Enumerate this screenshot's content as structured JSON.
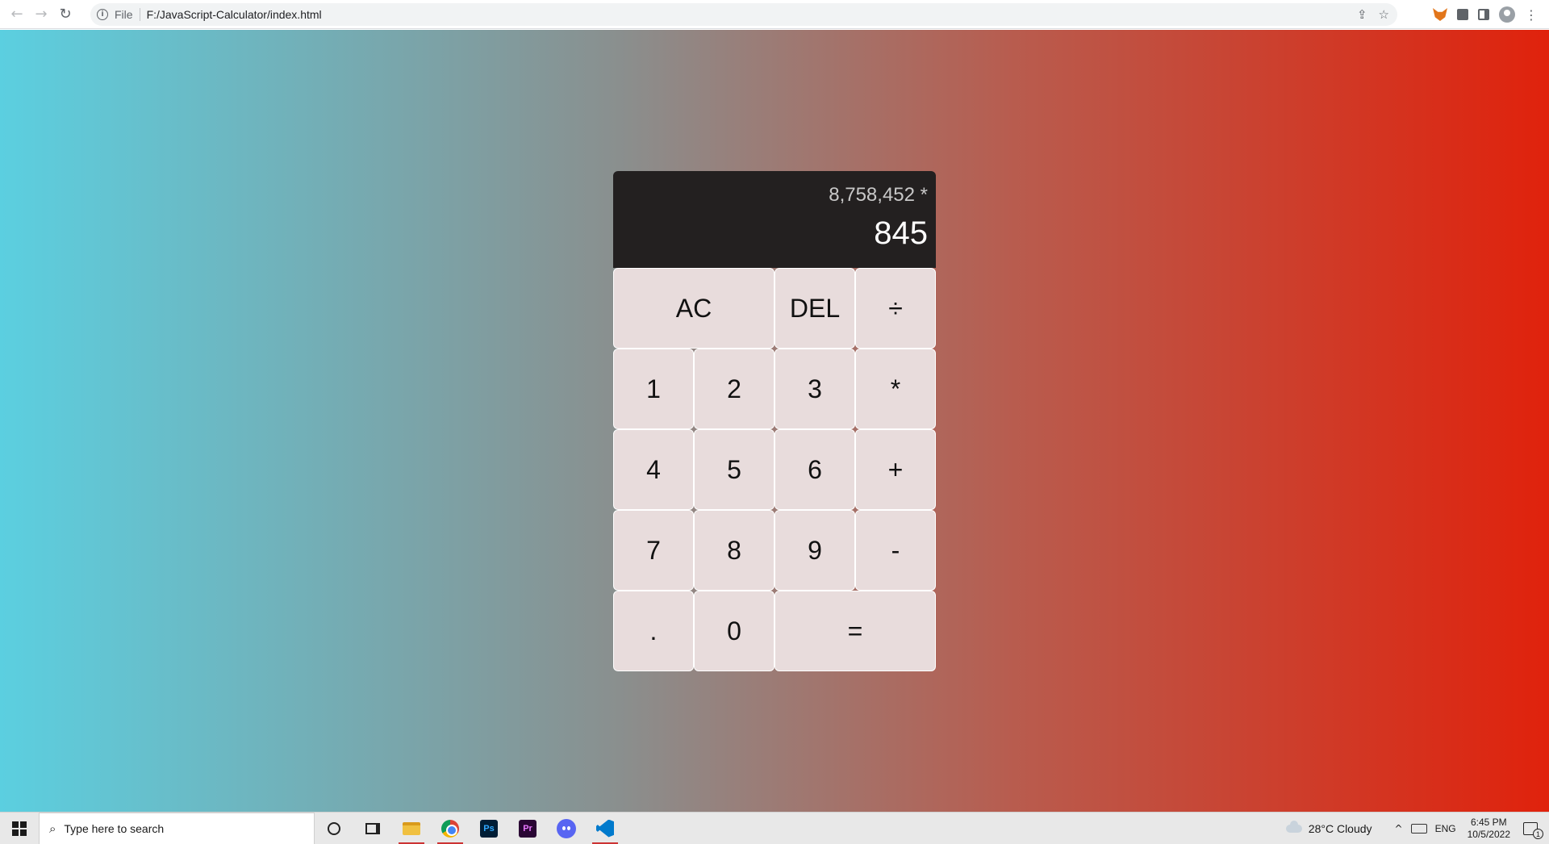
{
  "browser": {
    "scheme_label": "File",
    "url": "F:/JavaScript-Calculator/index.html"
  },
  "calculator": {
    "previous_operand": "8,758,452 *",
    "current_operand": "845",
    "buttons": {
      "ac": "AC",
      "del": "DEL",
      "divide": "÷",
      "one": "1",
      "two": "2",
      "three": "3",
      "multiply": "*",
      "four": "4",
      "five": "5",
      "six": "6",
      "plus": "+",
      "seven": "7",
      "eight": "8",
      "nine": "9",
      "minus": "-",
      "dot": ".",
      "zero": "0",
      "equals": "="
    }
  },
  "taskbar": {
    "search_placeholder": "Type here to search",
    "weather": "28°C  Cloudy",
    "language": "ENG",
    "time": "6:45 PM",
    "date": "10/5/2022",
    "notification_count": "1"
  },
  "colors": {
    "gradient_left": "#5bcfe0",
    "gradient_right": "#e0220c",
    "display_background": "#232020",
    "button_background": "#e8dcdc"
  }
}
